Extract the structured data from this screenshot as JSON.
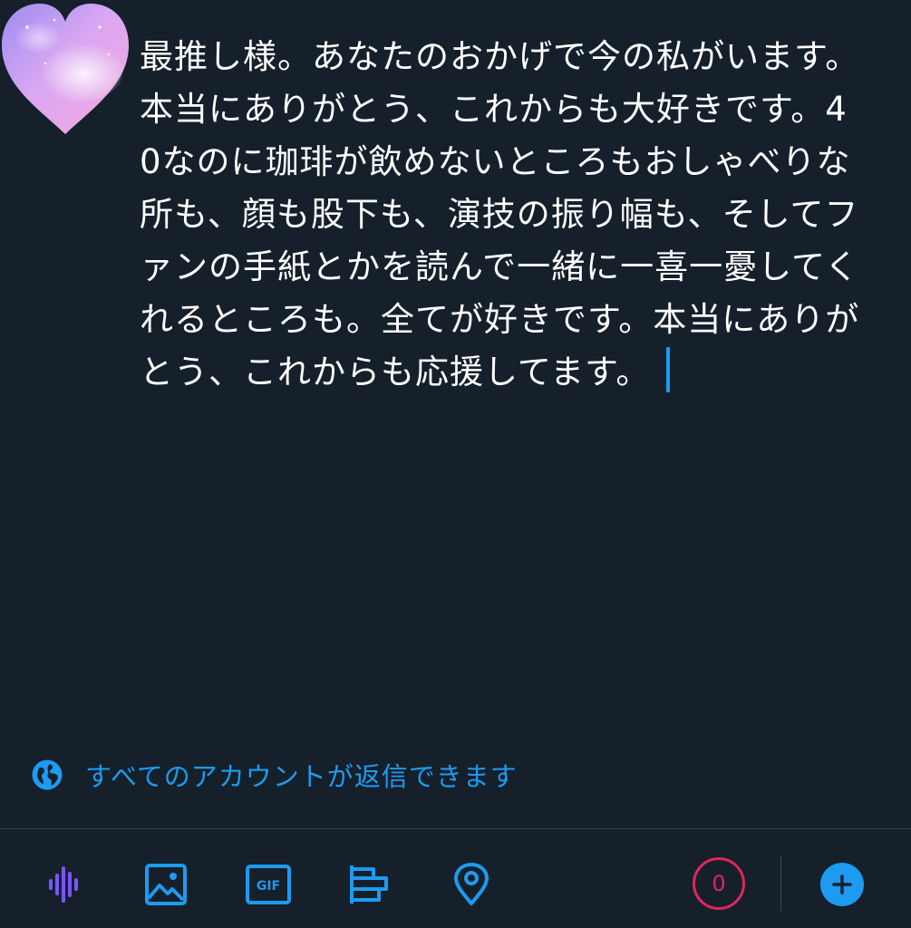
{
  "compose": {
    "text": "最推し様。あなたのおかげで今の私がいます。本当にありがとう、これからも大好きです。40なのに珈琲が飲めないところもおしゃべりな所も、顔も股下も、演技の振り幅も、そしてファンの手紙とかを読んで一緒に一喜一憂してくれるところも。全てが好きです。本当にありがとう、これからも応援してます。"
  },
  "reply_setting": {
    "label": "すべてのアカウントが返信できます",
    "icon": "globe-icon"
  },
  "toolbar": {
    "icons": [
      "voice-icon",
      "image-icon",
      "gif-icon",
      "poll-icon",
      "location-icon"
    ],
    "gif_label": "GIF",
    "char_counter": "0",
    "add_icon": "plus-icon"
  },
  "colors": {
    "background": "#15202b",
    "accent": "#1d9bf0",
    "text": "#ffffff",
    "voice": "#7856ff",
    "counter": "#e0245e",
    "divider": "#38444d"
  }
}
